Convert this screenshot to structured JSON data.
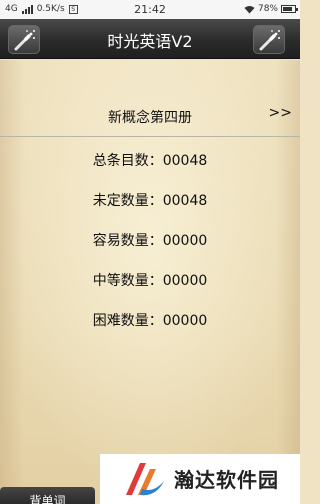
{
  "status_bar": {
    "network": "4G",
    "speed": "0.5K/s",
    "s_icon": "S",
    "time": "21:42",
    "battery": "78%"
  },
  "header": {
    "title": "时光英语V2",
    "left_icon": "magic-wand-icon",
    "right_icon": "magic-wand-icon"
  },
  "book": {
    "title": "新概念第四册",
    "next_label": ">>"
  },
  "stats": [
    {
      "label": "总条目数",
      "value": "00048",
      "text": "总条目数：00048"
    },
    {
      "label": "未定数量",
      "value": "00048",
      "text": "未定数量：00048"
    },
    {
      "label": "容易数量",
      "value": "00000",
      "text": "容易数量：00000"
    },
    {
      "label": "中等数量",
      "value": "00000",
      "text": "中等数量：00000"
    },
    {
      "label": "困难数量",
      "value": "00000",
      "text": "困难数量：00000"
    }
  ],
  "bottom": {
    "button_label": "背单词"
  },
  "watermark": {
    "text": "瀚达软件园"
  },
  "colors": {
    "titlebar": "#2b2b2b",
    "paper": "#efe2c0",
    "text": "#111111"
  }
}
